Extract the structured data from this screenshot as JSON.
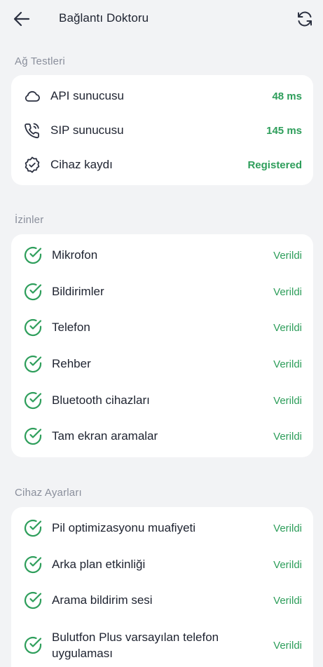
{
  "header": {
    "title": "Bağlantı Doktoru",
    "back_icon": "arrow-left-icon",
    "refresh_icon": "refresh-icon"
  },
  "colors": {
    "background": "#F2F3F5",
    "card": "#FFFFFF",
    "success": "#2E9E5B",
    "section_label": "#8A8F9C",
    "text": "#1E2330"
  },
  "network": {
    "label": "Ağ Testleri",
    "items": [
      {
        "icon": "cloud-icon",
        "label": "API sunucusu",
        "value": "48 ms"
      },
      {
        "icon": "phone-call-icon",
        "label": "SIP sunucusu",
        "value": "145 ms"
      },
      {
        "icon": "badge-check-icon",
        "label": "Cihaz kaydı",
        "value": "Registered"
      }
    ]
  },
  "permissions": {
    "label": "İzinler",
    "items": [
      {
        "icon": "check-circle-icon",
        "label": "Mikrofon",
        "value": "Verildi"
      },
      {
        "icon": "check-circle-icon",
        "label": "Bildirimler",
        "value": "Verildi"
      },
      {
        "icon": "check-circle-icon",
        "label": "Telefon",
        "value": "Verildi"
      },
      {
        "icon": "check-circle-icon",
        "label": "Rehber",
        "value": "Verildi"
      },
      {
        "icon": "check-circle-icon",
        "label": "Bluetooth cihazları",
        "value": "Verildi"
      },
      {
        "icon": "check-circle-icon",
        "label": "Tam ekran aramalar",
        "value": "Verildi"
      }
    ]
  },
  "device_settings": {
    "label": "Cihaz Ayarları",
    "items": [
      {
        "icon": "check-circle-icon",
        "label": "Pil optimizasyonu muafiyeti",
        "value": "Verildi"
      },
      {
        "icon": "check-circle-icon",
        "label": "Arka plan etkinliği",
        "value": "Verildi"
      },
      {
        "icon": "check-circle-icon",
        "label": "Arama bildirim sesi",
        "value": "Verildi"
      },
      {
        "icon": "check-circle-icon",
        "label": "Bulutfon Plus varsayılan telefon uygulaması",
        "value": "Verildi"
      }
    ]
  }
}
